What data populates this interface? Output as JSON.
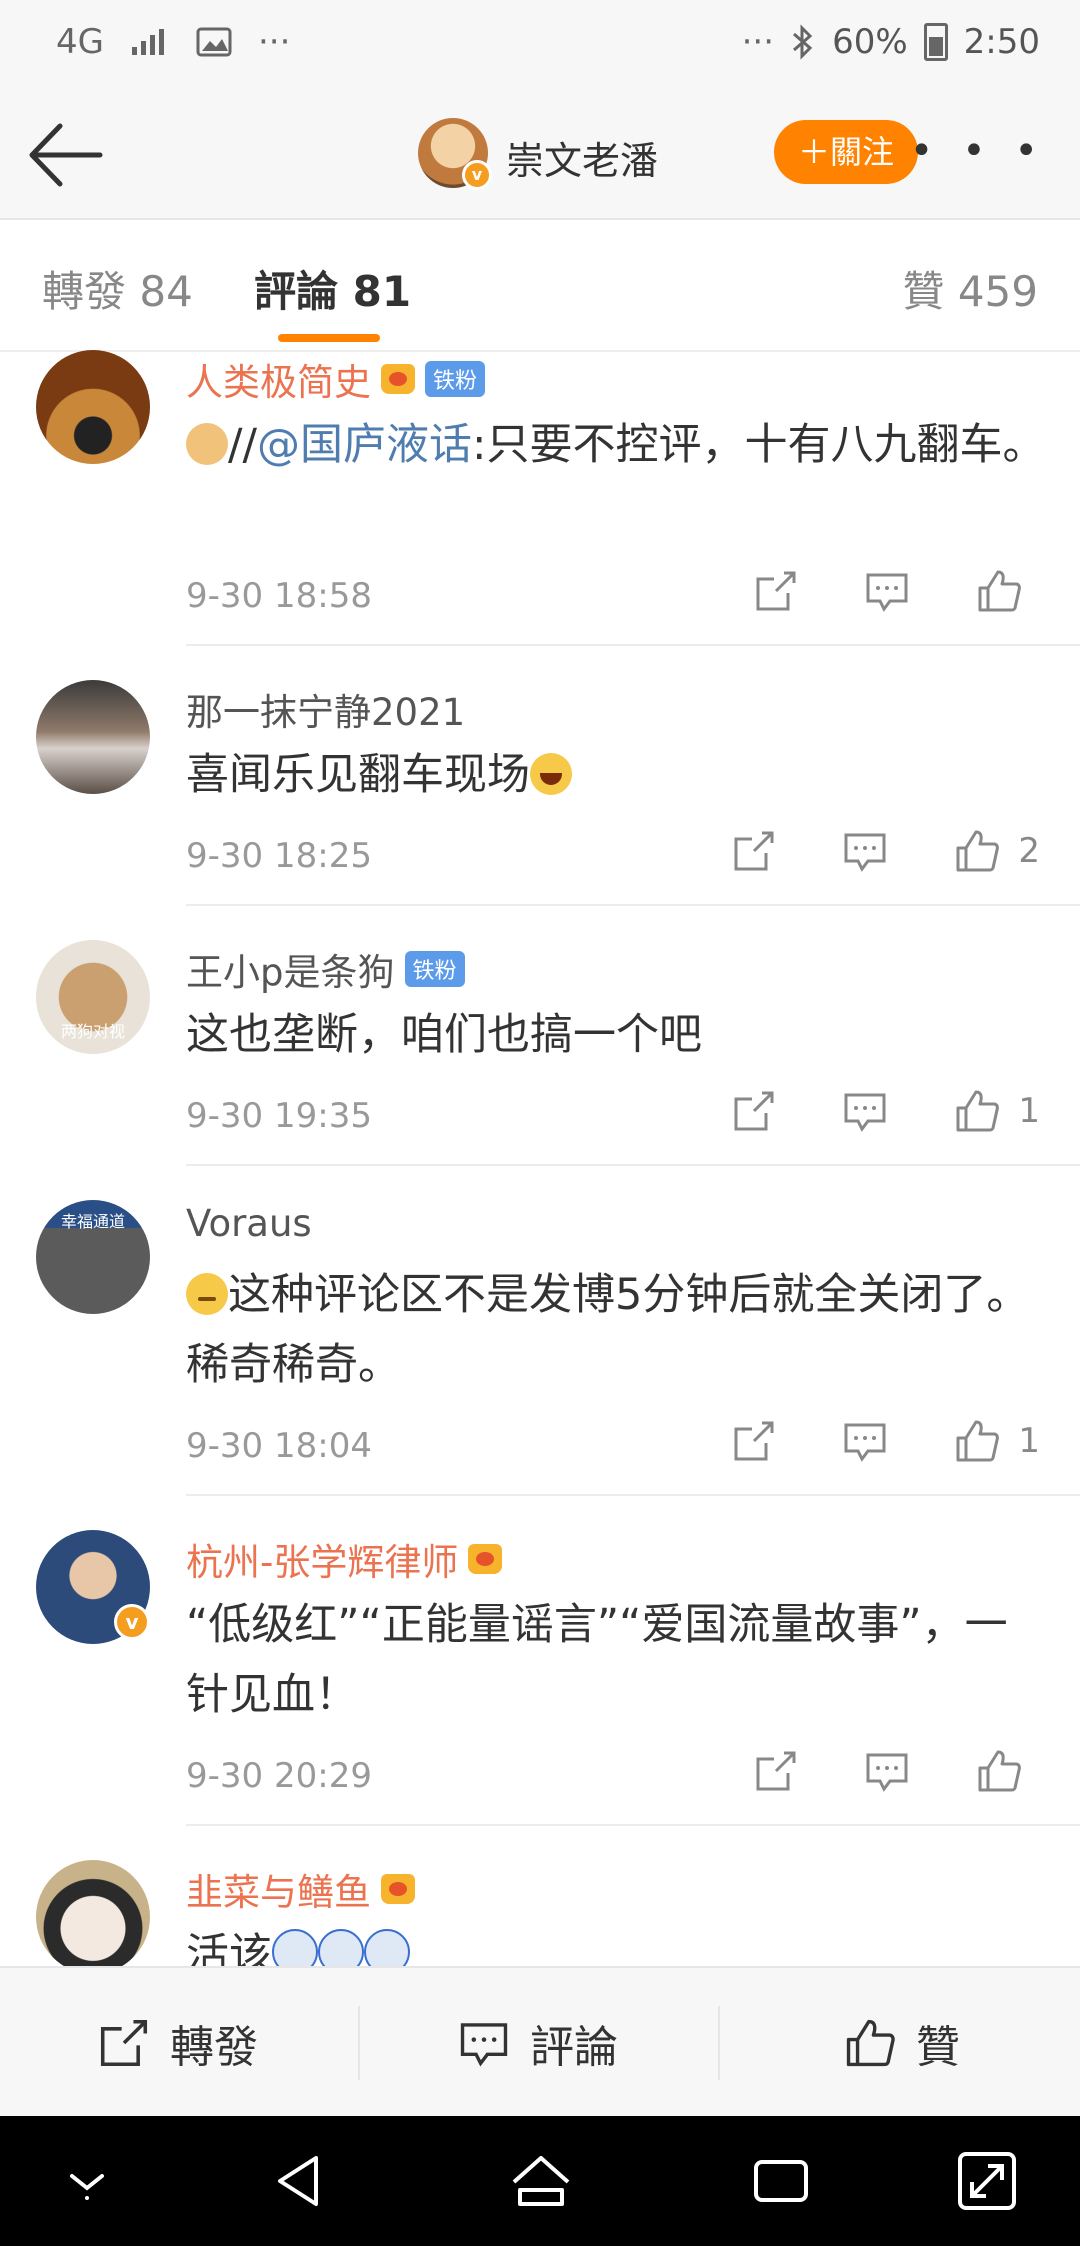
{
  "status_bar": {
    "network": "4G",
    "dots_left": "···",
    "dots_right": "···",
    "battery": "60%",
    "time": "2:50"
  },
  "header": {
    "account_name": "崇文老潘",
    "follow_label": "＋關注",
    "more": "• • •"
  },
  "tabs": {
    "repost": "轉發 84",
    "comment": "評論 81",
    "like": "贊 459"
  },
  "comments": [
    {
      "name": "人类极简史",
      "badge": "铁粉",
      "text_prefix": "//",
      "mention": "@国庐液话",
      "text": ":只要不控评，十有八九翻车。",
      "time": "9-30 18:58",
      "likes": ""
    },
    {
      "name": "那一抹宁静2021",
      "text": "喜闻乐见翻车现场",
      "time": "9-30 18:25",
      "likes": "2"
    },
    {
      "name": "王小p是条狗",
      "badge": "铁粉",
      "avatar_caption": "两狗对视",
      "text": "这也垄断，咱们也搞一个吧",
      "time": "9-30 19:35",
      "likes": "1"
    },
    {
      "name": "Voraus",
      "avatar_caption": "幸福通道",
      "text": "这种评论区不是发博5分钟后就全关闭了。稀奇稀奇。",
      "time": "9-30 18:04",
      "likes": "1"
    },
    {
      "name": "杭州-张学辉律师",
      "text": "“低级红”“正能量谣言”“爱国流量故事”，一针见血！",
      "time": "9-30 20:29",
      "likes": ""
    },
    {
      "name": "韭菜与鳝鱼",
      "text": "活该",
      "time": "",
      "likes": ""
    }
  ],
  "bottom_bar": {
    "repost": "轉發",
    "comment": "評論",
    "like": "贊"
  },
  "colors": {
    "accent": "#ff8200",
    "vip_name": "#eb7350",
    "mention": "#507daf"
  }
}
